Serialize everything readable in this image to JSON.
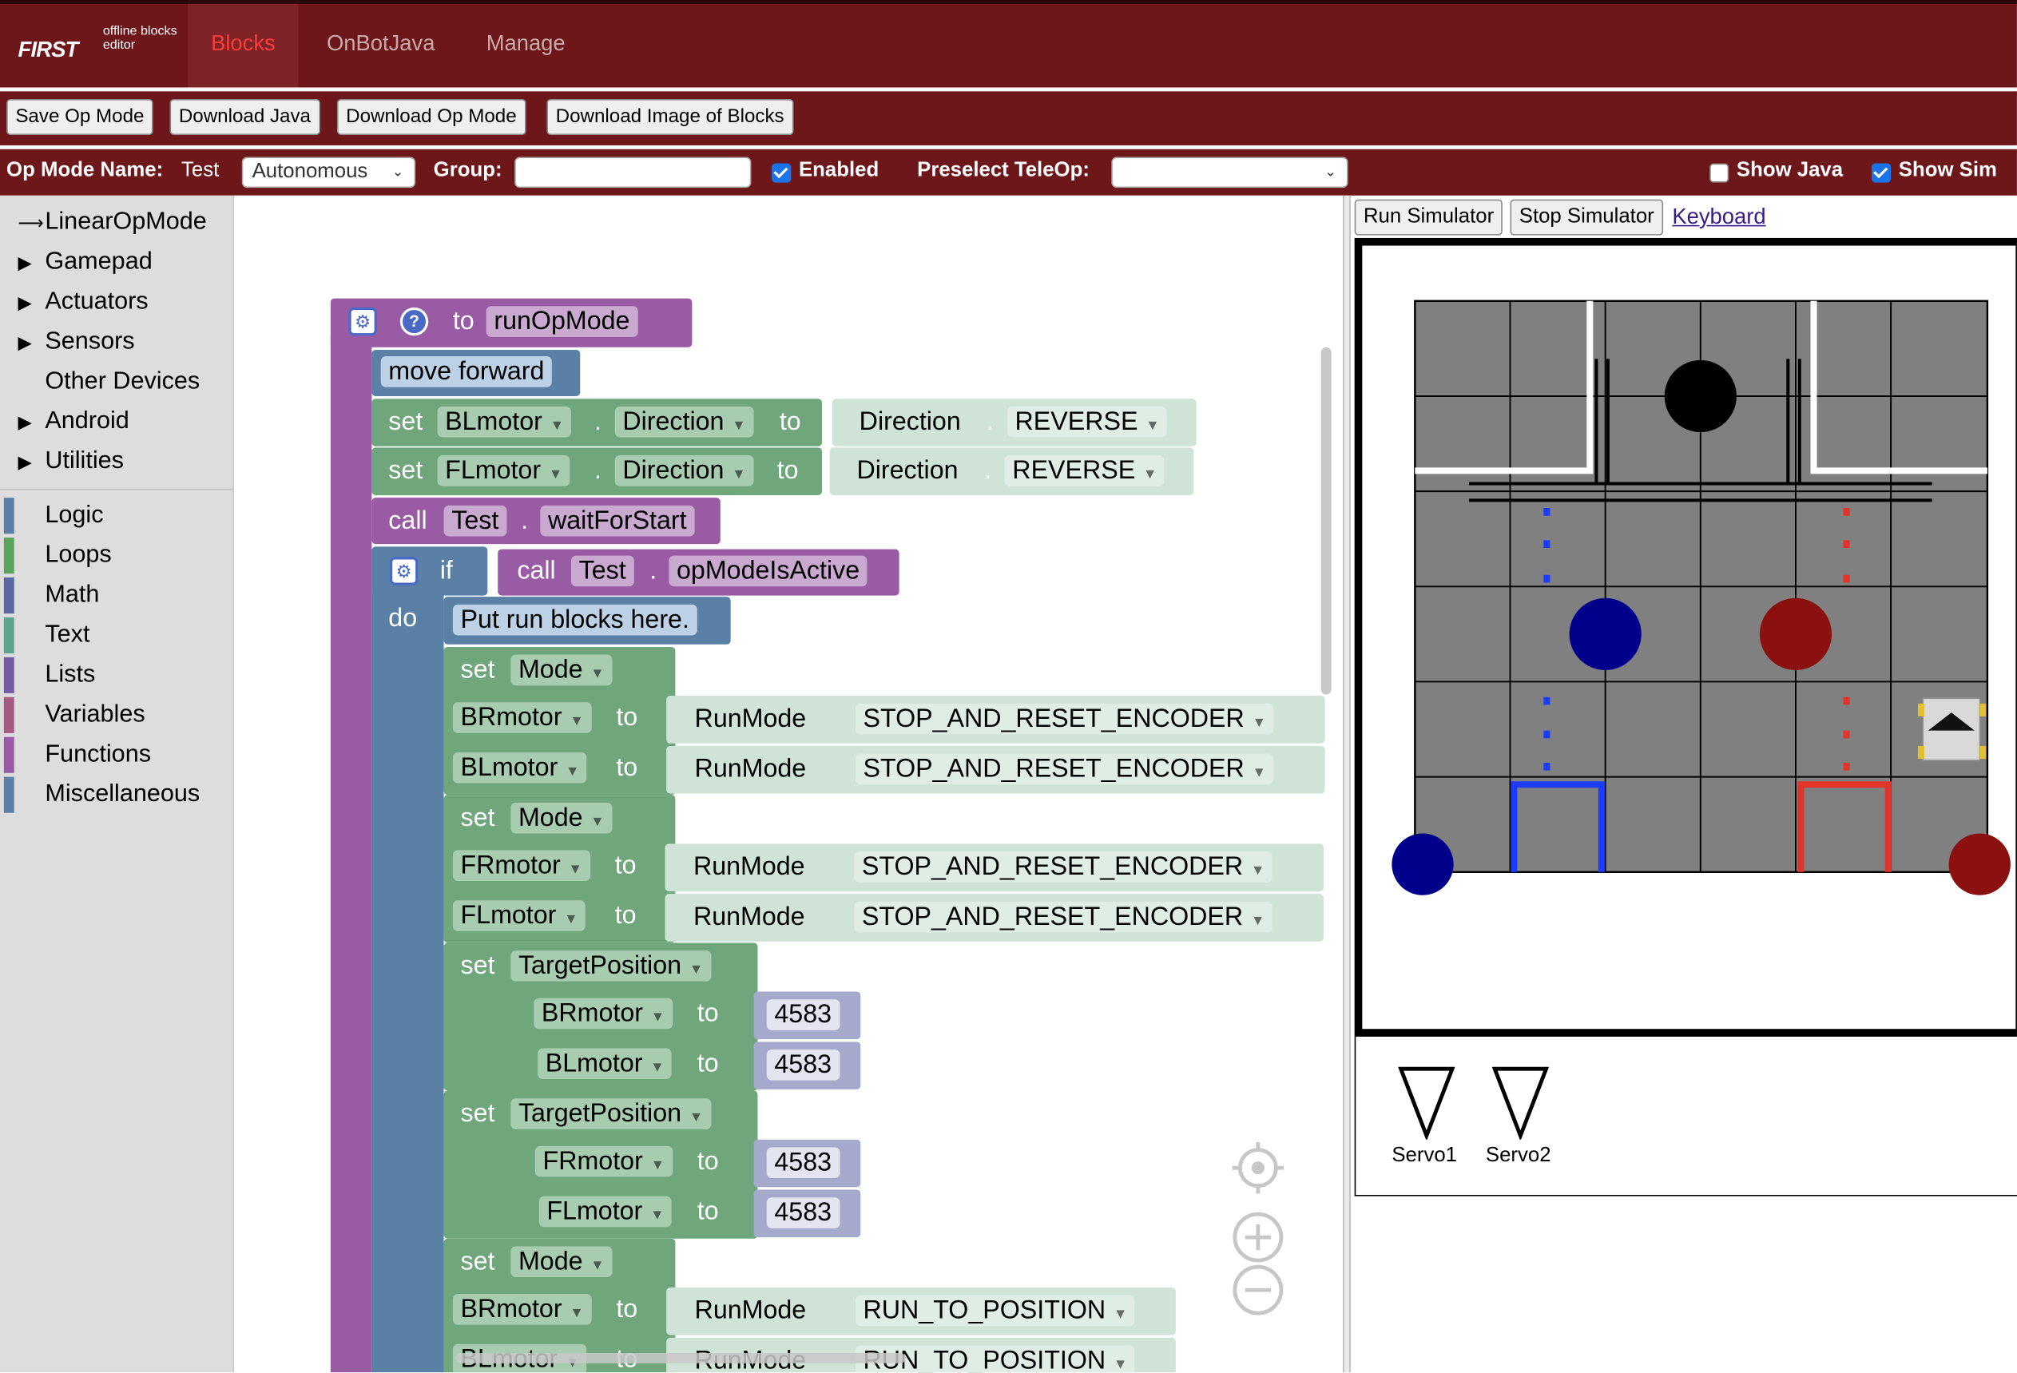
{
  "app": {
    "brand": "FIRST",
    "brand_sub": "offline blocks editor"
  },
  "nav": {
    "tabs": [
      {
        "label": "Blocks"
      },
      {
        "label": "OnBotJava"
      },
      {
        "label": "Manage"
      }
    ]
  },
  "toolbar": {
    "buttons": [
      "Save Op Mode",
      "Download Java",
      "Download Op Mode",
      "Download Image of Blocks"
    ]
  },
  "opmode": {
    "name_label": "Op Mode Name:",
    "name_value": "Test",
    "type_value": "Autonomous",
    "group_label": "Group:",
    "group_value": "",
    "enabled_label": "Enabled",
    "enabled": true,
    "preselect_label": "Preselect TeleOp:",
    "preselect_value": "",
    "show_java_label": "Show Java",
    "show_java": false,
    "show_sim_label": "Show Sim",
    "show_sim": true
  },
  "toolbox": {
    "top_items": [
      {
        "label": "LinearOpMode",
        "icon": "arrow-right-icon"
      },
      {
        "label": "Gamepad",
        "icon": "triangle-right-icon"
      },
      {
        "label": "Actuators",
        "icon": "triangle-right-icon"
      },
      {
        "label": "Sensors",
        "icon": "triangle-right-icon"
      },
      {
        "label": "Other Devices",
        "icon": ""
      },
      {
        "label": "Android",
        "icon": "triangle-right-icon"
      },
      {
        "label": "Utilities",
        "icon": "triangle-right-icon"
      }
    ],
    "categories": [
      {
        "label": "Logic",
        "color": "#5b80a5"
      },
      {
        "label": "Loops",
        "color": "#5ba55b"
      },
      {
        "label": "Math",
        "color": "#5b67a5"
      },
      {
        "label": "Text",
        "color": "#5ba58c"
      },
      {
        "label": "Lists",
        "color": "#745ba5"
      },
      {
        "label": "Variables",
        "color": "#a55b80"
      },
      {
        "label": "Functions",
        "color": "#995ba5"
      },
      {
        "label": "Miscellaneous",
        "color": "#5b80a5"
      }
    ]
  },
  "blocks": {
    "fn_to": "to",
    "fn_name": "runOpMode",
    "comment": "move forward",
    "set": "set",
    "to": "to",
    "dot": ".",
    "call": "call",
    "if": "if",
    "do": "do",
    "blmotor": "BLmotor",
    "flmotor": "FLmotor",
    "brmotor": "BRmotor",
    "frmotor": "FRmotor",
    "direction": "Direction",
    "reverse": "REVERSE",
    "test": "Test",
    "wait": "waitForStart",
    "active": "opModeIsActive",
    "run_comment": "Put run blocks here.",
    "mode": "Mode",
    "runmode": "RunMode",
    "stop_reset": "STOP_AND_RESET_ENCODER",
    "run_to_pos": "RUN_TO_POSITION",
    "target": "TargetPosition",
    "target_value": "4583"
  },
  "simulator": {
    "run_label": "Run Simulator",
    "stop_label": "Stop Simulator",
    "keyboard_label": "Keyboard",
    "servos": [
      "Servo1",
      "Servo2"
    ],
    "colors": {
      "field": "#808080",
      "blue": "#00008b",
      "red": "#8b1010",
      "accent_red": "#6e171a"
    }
  }
}
